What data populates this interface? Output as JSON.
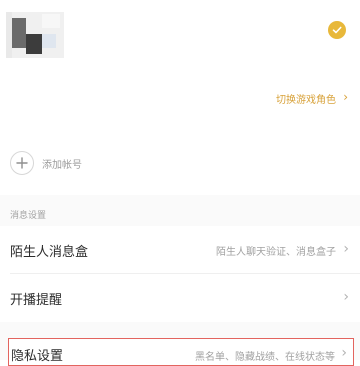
{
  "account": {
    "switch_role_label": "切换游戏角色",
    "switch_role_chevron": "›",
    "selected_check_color": "#e8b83a"
  },
  "add_account": {
    "icon_glyph": "+",
    "label": "添加帐号"
  },
  "message_settings": {
    "section_title": "消息设置",
    "rows": [
      {
        "label": "陌生人消息盒",
        "value": "陌生人聊天验证、消息盒子",
        "chevron": "›"
      },
      {
        "label": "开播提醒",
        "value": "",
        "chevron": "›"
      }
    ]
  },
  "privacy": {
    "label": "隐私设置",
    "value": "黑名单、隐藏战绩、在线状态等",
    "chevron": "›",
    "highlight_color": "#e3645f"
  }
}
